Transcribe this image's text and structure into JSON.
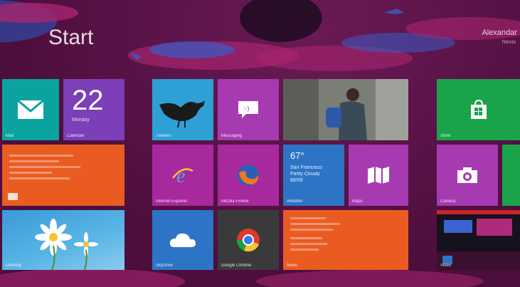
{
  "header": {
    "title": "Start",
    "user_name": "Alexandar",
    "user_sub": "Nikola"
  },
  "tiles": {
    "mail": {
      "label": "Mail"
    },
    "calendar": {
      "label": "Calendar",
      "date": "22",
      "day": "Monday"
    },
    "messaging": {
      "label": ""
    },
    "photos_small": {
      "label": ""
    },
    "desktop": {
      "label": "Desktop"
    },
    "people_bird": {
      "label": "Tweetro"
    },
    "messaging2": {
      "label": "Messaging"
    },
    "photo": {
      "label": ""
    },
    "ie": {
      "label": "Internet Explorer"
    },
    "firefox": {
      "label": "Mozilla Firefox"
    },
    "weather": {
      "label": "Weather",
      "temp": "67°",
      "city": "San Francisco",
      "cond": "Partly Cloudy",
      "range": "68/59"
    },
    "maps": {
      "label": "Maps"
    },
    "skydrive": {
      "label": "SkyDrive"
    },
    "chrome": {
      "label": "Google Chrome"
    },
    "news": {
      "label": "News"
    },
    "store": {
      "label": "Store"
    },
    "camera": {
      "label": "Camera"
    },
    "video": {
      "label": "Video"
    }
  },
  "colors": {
    "background": "#5a1146",
    "teal": "#0aa3a0",
    "purple": "#7c3fb8",
    "orange": "#ea5b22",
    "blue": "#2d74c6",
    "magenta": "#9a2a9a",
    "green": "#1ba34a"
  }
}
